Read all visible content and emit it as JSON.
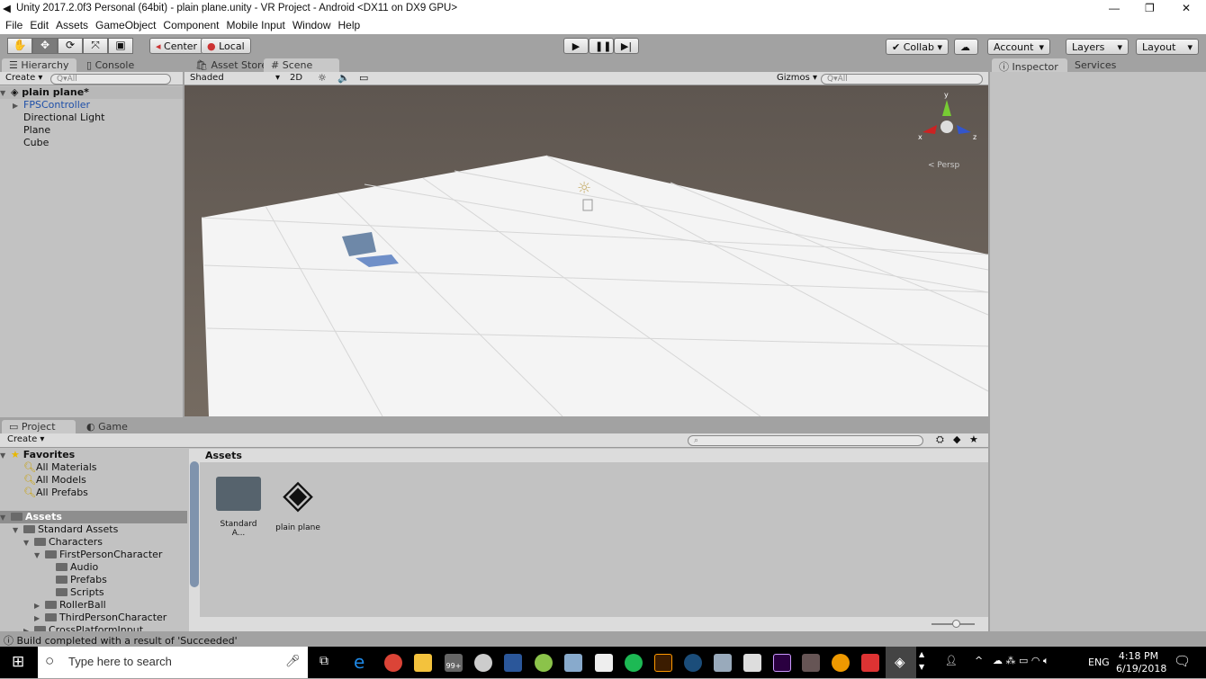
{
  "window": {
    "title": "Unity 2017.2.0f3 Personal (64bit) - plain plane.unity - VR Project - Android <DX11 on DX9 GPU>",
    "minimize": "—",
    "restore": "❐",
    "close": "✕"
  },
  "menu": [
    "File",
    "Edit",
    "Assets",
    "GameObject",
    "Component",
    "Mobile Input",
    "Window",
    "Help"
  ],
  "toolbar": {
    "center": "Center",
    "local": "Local",
    "collab": "Collab ▾",
    "account": "Account",
    "layers": "Layers",
    "layout": "Layout"
  },
  "tabs": {
    "hierarchy": "Hierarchy",
    "console": "Console",
    "asset_store": "Asset Store",
    "scene": "Scene",
    "inspector": "Inspector",
    "services": "Services",
    "project": "Project",
    "game": "Game"
  },
  "hierarchy": {
    "create": "Create ▾",
    "search_placeholder": "Q▾All",
    "scene": "plain plane*",
    "items": [
      "FPSController",
      "Directional Light",
      "Plane",
      "Cube"
    ]
  },
  "scene": {
    "shading": "Shaded",
    "mode2d": "2D",
    "gizmos": "Gizmos ▾",
    "search_placeholder": "Q▾All",
    "persp": "Persp",
    "axis_x": "x",
    "axis_y": "y",
    "axis_z": "z"
  },
  "project": {
    "create": "Create ▾",
    "favorites": "Favorites",
    "fav_items": [
      "All Materials",
      "All Models",
      "All Prefabs"
    ],
    "assets": "Assets",
    "tree": [
      "Standard Assets",
      "Characters",
      "FirstPersonCharacter",
      "Audio",
      "Prefabs",
      "Scripts",
      "RollerBall",
      "ThirdPersonCharacter",
      "CrossPlatformInput"
    ],
    "breadcrumb": "Assets",
    "grid": [
      {
        "label": "Standard A..."
      },
      {
        "label": "plain plane"
      }
    ]
  },
  "status": "Build completed with a result of 'Succeeded'",
  "taskbar": {
    "search": "Type here to search",
    "badge": "99+",
    "lang": "ENG",
    "time": "4:18 PM",
    "date": "6/19/2018"
  }
}
